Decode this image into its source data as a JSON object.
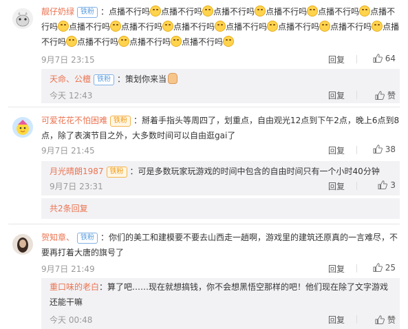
{
  "comments": [
    {
      "user": "靓仔奶绿",
      "badge": "铁粉",
      "text_unit": "点播不行吗",
      "time": "9月7日 23:15",
      "reply_label": "回复",
      "likes": "64",
      "sub": {
        "user": "天命、公檀",
        "badge": "铁粉",
        "text": "：策划你来当",
        "time": "今天 12:43",
        "reply_label": "回复",
        "likes": "赞"
      }
    },
    {
      "user": "可爱花花不怕困难",
      "badge": "铁粉",
      "text": "：掰着手指头等周四了，划重点，自由观光12点到下午2点，晚上6点到8点，除了表演节目之外，大多数时间可以自由逛gai了",
      "time": "9月7日 21:45",
      "reply_label": "回复",
      "likes": "38",
      "sub": {
        "user": "月光晴朗1987",
        "badge": "铁粉",
        "text": "：可是多数玩家玩游戏的时间中包含的自由时间只有一个小时40分钟",
        "time": "9月7日 23:31",
        "reply_label": "回复",
        "likes": "3"
      },
      "more": "共2条回复"
    },
    {
      "user": "贺知章、",
      "badge": "铁粉",
      "text": "：你们的美工和建模要不要去山西走一趟啊，游戏里的建筑还原真的一言难尽，不要再打着大唐的旗号了",
      "time": "9月7日 21:49",
      "reply_label": "回复",
      "likes": "25",
      "sub": {
        "user": "重口味的老白",
        "text": "：算了吧……现在就想搞钱，你不会想黑悟空那样的吧！他们现在除了文字游戏还能干嘛",
        "time": "今天 00:48",
        "reply_label": "回复",
        "likes": "赞"
      }
    }
  ],
  "colors": {
    "username": "#eb7350",
    "sub_bg": "#f2f2f5",
    "badge": "#5a9de0"
  }
}
